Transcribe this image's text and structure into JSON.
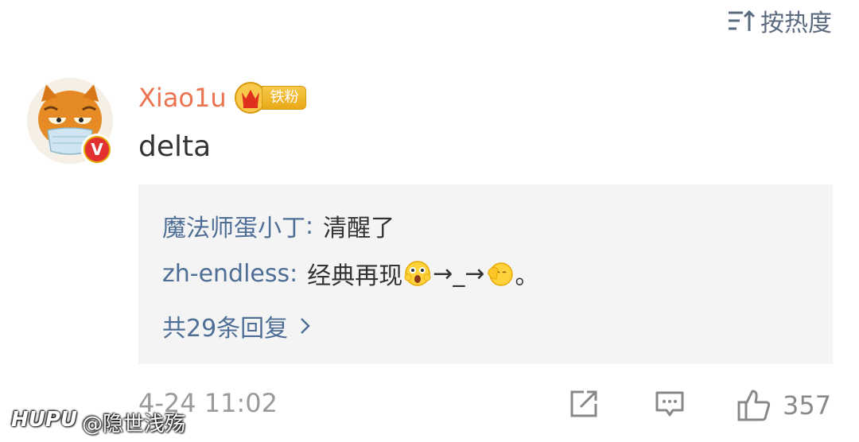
{
  "sort": {
    "label": "按热度",
    "icon": "sort-icon"
  },
  "comment": {
    "username": "Xiao1u",
    "badge_label": "铁粉",
    "verified_mark": "V",
    "text": "delta",
    "timestamp": "4-24 11:02",
    "like_count": "357"
  },
  "replies": {
    "items": [
      {
        "user": "魔法师蛋小丁",
        "separator": ":",
        "text_before": "清醒了",
        "text_after": ""
      },
      {
        "user": "zh-endless",
        "separator": ":",
        "text_before": "经典再现",
        "arrow1": "→_→",
        "text_after": "。"
      }
    ],
    "more_label": "共29条回复"
  },
  "watermark": {
    "brand": "HUPU",
    "handle": "@隐世浅殇"
  },
  "colors": {
    "username": "#eb7350",
    "reply_user": "#4e6e96",
    "muted": "#9a9a9a",
    "reply_bg": "#f4f4f4"
  }
}
